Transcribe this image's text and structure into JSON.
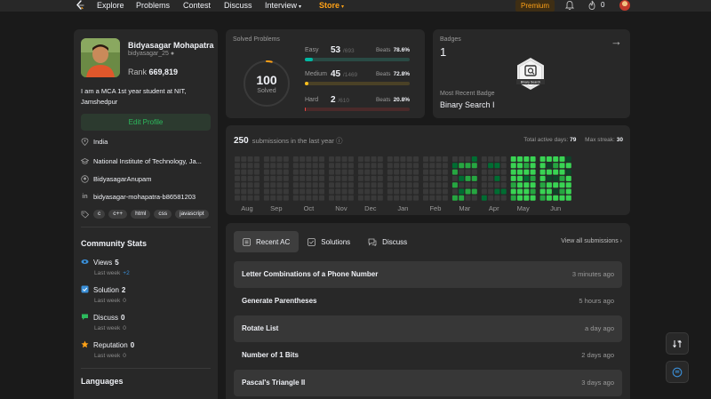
{
  "nav": {
    "items": [
      {
        "label": "Explore",
        "active": false
      },
      {
        "label": "Problems",
        "active": false
      },
      {
        "label": "Contest",
        "active": false
      },
      {
        "label": "Discuss",
        "active": false
      },
      {
        "label": "Interview",
        "active": false,
        "caret": "▾"
      },
      {
        "label": "Store",
        "active": true,
        "caret": "▾"
      }
    ],
    "premium": "Premium",
    "streak": "0",
    "accent_color": "#ffa116"
  },
  "profile": {
    "name": "Bidyasagar Mohapatra",
    "username": "bidyasagar_25",
    "rank_label": "Rank",
    "rank": "669,819",
    "bio": "I am a MCA 1st year student at NIT, Jamshedpur",
    "edit_label": "Edit Profile",
    "location": "India",
    "school": "National Institute of Technology, Ja...",
    "github": "BidyasagarAnupam",
    "linkedin": "bidyasagar-mohapatra-b86581203",
    "tags": [
      "c",
      "c++",
      "html",
      "css",
      "javascript"
    ]
  },
  "community": {
    "title": "Community Stats",
    "stats": [
      {
        "label": "Views",
        "value": "5",
        "sub": "Last week",
        "delta": "+2",
        "color": "#3a8fd8"
      },
      {
        "label": "Solution",
        "value": "2",
        "sub": "Last week",
        "delta": "0",
        "color": "#3a8fd8"
      },
      {
        "label": "Discuss",
        "value": "0",
        "sub": "Last week",
        "delta": "0",
        "color": "#2cbb5d"
      },
      {
        "label": "Reputation",
        "value": "0",
        "sub": "Last week",
        "delta": "0",
        "color": "#ffa116"
      }
    ]
  },
  "languages": {
    "title": "Languages"
  },
  "solved": {
    "title": "Solved Problems",
    "total": "100",
    "total_label": "Solved",
    "total_questions": 2722,
    "difficulties": [
      {
        "name": "Easy",
        "count": "53",
        "total": "/693",
        "beats_label": "Beats",
        "beats": "78.6%",
        "color": "#00b8a3",
        "track": "#2a4a44",
        "fraction": 0.076
      },
      {
        "name": "Medium",
        "count": "45",
        "total": "/1469",
        "beats_label": "Beats",
        "beats": "72.8%",
        "color": "#ffc01e",
        "track": "#4a4126",
        "fraction": 0.031
      },
      {
        "name": "Hard",
        "count": "2",
        "total": "/610",
        "beats_label": "Beats",
        "beats": "20.8%",
        "color": "#ef4743",
        "track": "#4a2a2a",
        "fraction": 0.003
      }
    ]
  },
  "badges": {
    "title": "Badges",
    "count": "1",
    "recent_label": "Most Recent Badge",
    "recent_name": "Binary Search I",
    "badge_caption": "Binary Search"
  },
  "heatmap": {
    "count": "250",
    "title": "submissions in the last year",
    "active_label": "Total active days:",
    "active_days": "79",
    "streak_label": "Max streak:",
    "max_streak": "30",
    "months": [
      "Aug",
      "Sep",
      "Oct",
      "Nov",
      "Dec",
      "Jan",
      "Feb",
      "Mar",
      "Apr",
      "May",
      "Jun"
    ],
    "colors": [
      "#393939",
      "#0e4429",
      "#006d32",
      "#26a641",
      "#39d353"
    ]
  },
  "submissions": {
    "tabs": [
      {
        "label": "Recent AC",
        "icon": "list-icon"
      },
      {
        "label": "Solutions",
        "icon": "solution-icon"
      },
      {
        "label": "Discuss",
        "icon": "discuss-icon"
      }
    ],
    "view_all": "View all submissions",
    "rows": [
      {
        "title": "Letter Combinations of a Phone Number",
        "time": "3 minutes ago"
      },
      {
        "title": "Generate Parentheses",
        "time": "5 hours ago"
      },
      {
        "title": "Rotate List",
        "time": "a day ago"
      },
      {
        "title": "Number of 1 Bits",
        "time": "2 days ago"
      },
      {
        "title": "Pascal's Triangle II",
        "time": "3 days ago"
      }
    ]
  }
}
